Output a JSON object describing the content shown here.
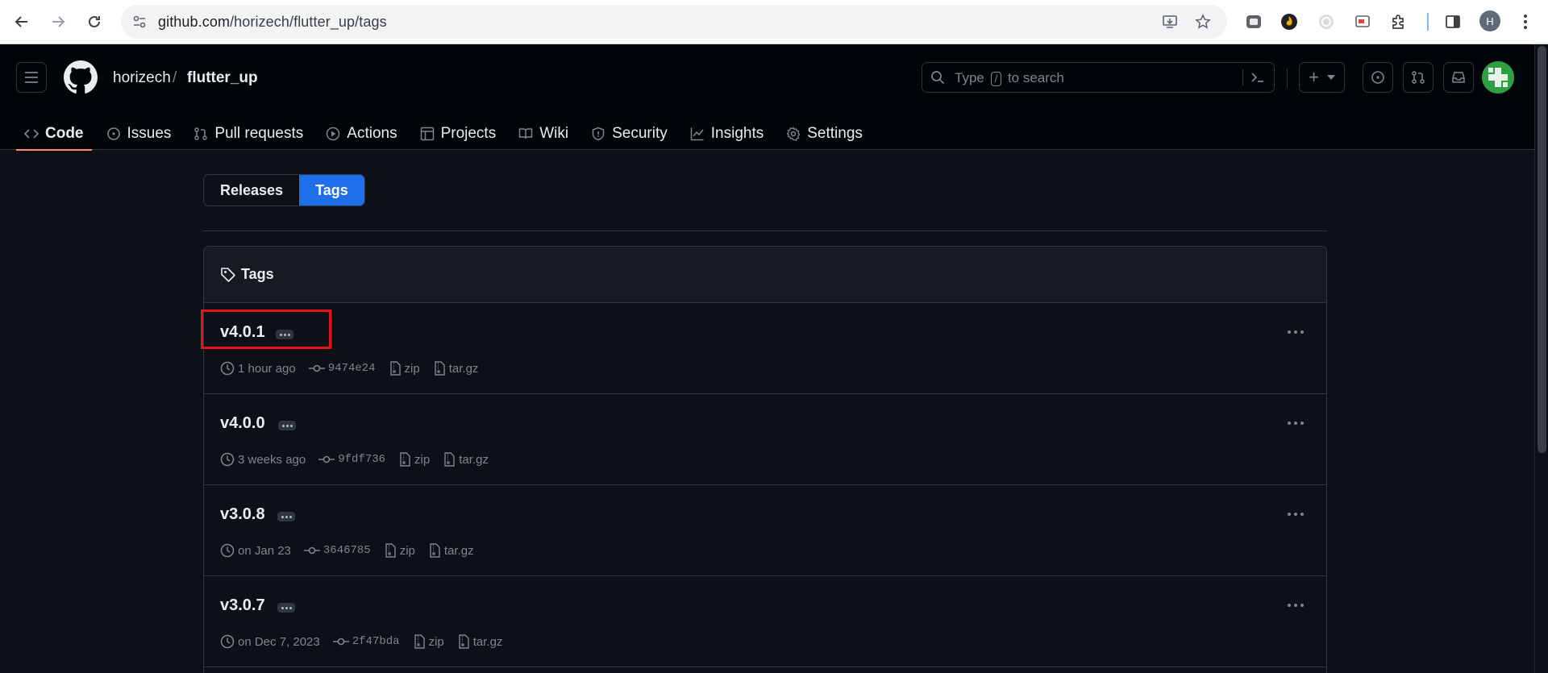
{
  "browser": {
    "url_host": "github.com",
    "url_path": "/horizech/flutter_up/tags",
    "profile_initial": "H"
  },
  "header": {
    "owner": "horizech",
    "separator": "/",
    "repo": "flutter_up",
    "search": {
      "prefix": "Type",
      "key": "/",
      "suffix": "to search"
    },
    "create_label": "+"
  },
  "repo_nav": {
    "tabs": [
      {
        "label": "Code",
        "icon": "code-icon",
        "active": true
      },
      {
        "label": "Issues",
        "icon": "issue-icon"
      },
      {
        "label": "Pull requests",
        "icon": "pull-request-icon"
      },
      {
        "label": "Actions",
        "icon": "play-icon"
      },
      {
        "label": "Projects",
        "icon": "table-icon"
      },
      {
        "label": "Wiki",
        "icon": "book-icon"
      },
      {
        "label": "Security",
        "icon": "shield-icon"
      },
      {
        "label": "Insights",
        "icon": "graph-icon"
      },
      {
        "label": "Settings",
        "icon": "gear-icon"
      }
    ]
  },
  "segmented": {
    "releases": "Releases",
    "tags": "Tags",
    "selected": "Tags"
  },
  "tags_box": {
    "title": "Tags",
    "download_zip": "zip",
    "download_targz": "tar.gz",
    "items": [
      {
        "name": "v4.0.1",
        "date": "1 hour ago",
        "sha": "9474e24"
      },
      {
        "name": "v4.0.0",
        "date": "3 weeks ago",
        "sha": "9fdf736"
      },
      {
        "name": "v3.0.8",
        "date": "on Jan 23",
        "sha": "3646785"
      },
      {
        "name": "v3.0.7",
        "date": "on Dec 7, 2023",
        "sha": "2f47bda"
      }
    ]
  },
  "colors": {
    "accent": "#1f6feb",
    "active_underline": "#fd8c73",
    "highlight_box": "#e5141b",
    "background": "#0d1117"
  }
}
